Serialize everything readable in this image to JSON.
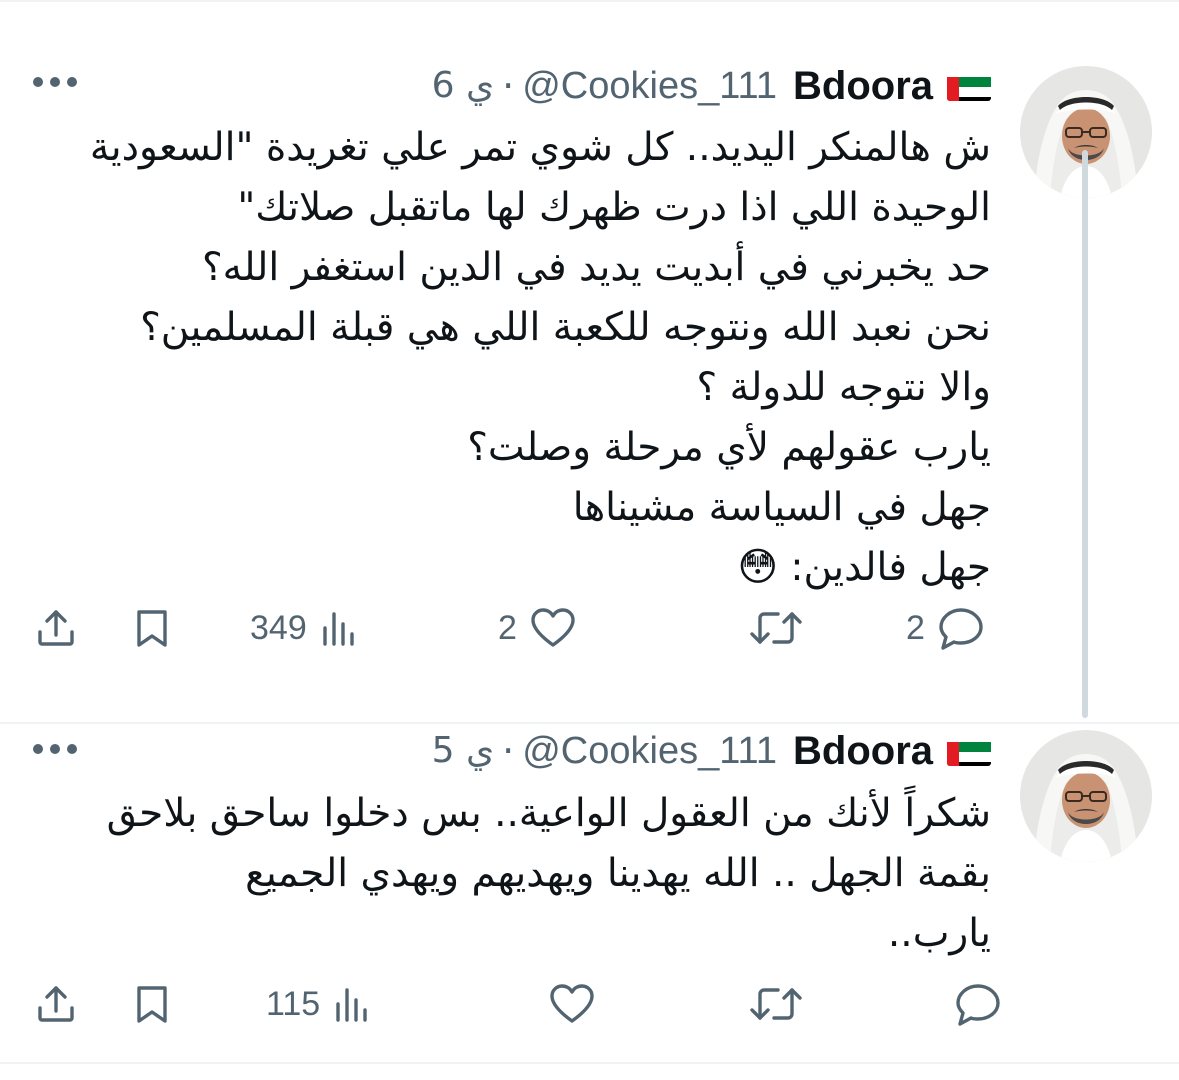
{
  "tweets": [
    {
      "name": "Bdoora",
      "flag": "uae-flag",
      "handle": "@Cookies_111",
      "separator": "·",
      "time": "6 ي",
      "lines": [
        "ش هالمنكر اليديد.. كل شوي تمر علي تغريدة \"السعودية",
        "الوحيدة اللي اذا درت ظهرك لها ماتقبل صلاتك\"",
        "حد يخبرني في أبديت يديد في الدين استغفر الله؟",
        "نحن نعبد الله ونتوجه للكعبة اللي هي قبلة المسلمين؟",
        "والا نتوجه للدولة ؟",
        "يارب عقولهم لأي مرحلة وصلت؟",
        "جهل في السياسة مشيناها",
        "جهل فالدين: 😳"
      ],
      "reply_count": "2",
      "retweet_count": "",
      "like_count": "2",
      "view_count": "349"
    },
    {
      "name": "Bdoora",
      "flag": "uae-flag",
      "handle": "@Cookies_111",
      "separator": "·",
      "time": "5 ي",
      "lines": [
        "شكراً لأنك من العقول الواعية.. بس دخلوا ساحق بلاحق",
        "بقمة الجهل .. الله يهدينا ويهديهم ويهدي الجميع",
        "يارب.."
      ],
      "reply_count": "",
      "retweet_count": "",
      "like_count": "",
      "view_count": "115"
    }
  ],
  "colors": {
    "text": "#0f1419",
    "secondary": "#536471",
    "divider": "#eff3f4",
    "thread_line": "#cfd9de"
  },
  "icons": [
    "more-icon",
    "reply-icon",
    "retweet-icon",
    "like-icon",
    "views-icon",
    "bookmark-icon",
    "share-icon",
    "uae-flag"
  ]
}
